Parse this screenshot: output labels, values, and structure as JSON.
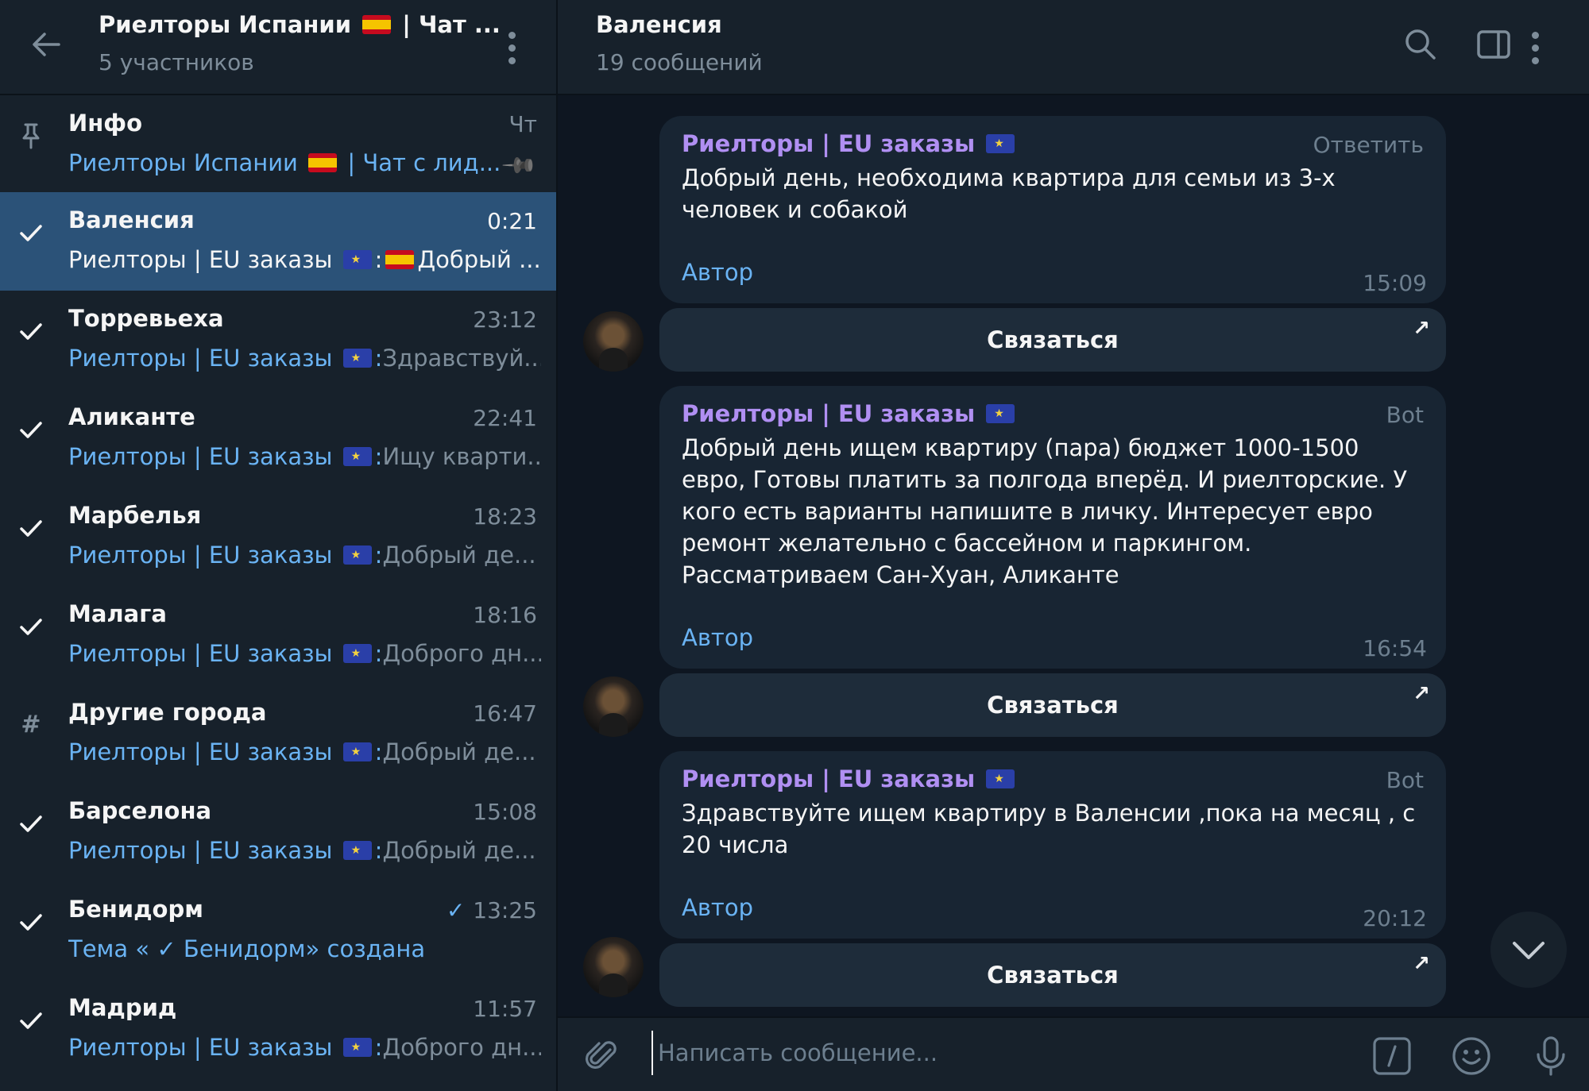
{
  "group": {
    "title": "Риелторы Испании 🇪🇸 | Чат ...",
    "title_text": "Риелторы Испании",
    "title_suffix": " | Чат ...",
    "members": "5 участников"
  },
  "topics": [
    {
      "name": "Инфо",
      "time": "Чт",
      "sender": "Риелторы Испании",
      "sender_suffix": " | Чат с лид...",
      "preview": "",
      "icon": "pin-icon",
      "active": false
    },
    {
      "name": "Валенсия",
      "time": "0:21",
      "sender": "Риелторы | EU заказы",
      "preview": "Добрый ...",
      "icon": "check-icon",
      "active": true
    },
    {
      "name": "Торревьеха",
      "time": "23:12",
      "sender": "Риелторы | EU заказы",
      "preview": "Здравствуй...",
      "icon": "check-icon",
      "active": false
    },
    {
      "name": "Аликанте",
      "time": "22:41",
      "sender": "Риелторы | EU заказы",
      "preview": "Ищу кварти...",
      "icon": "check-icon",
      "active": false
    },
    {
      "name": "Марбелья",
      "time": "18:23",
      "sender": "Риелторы | EU заказы",
      "preview": "Добрый де...",
      "icon": "check-icon",
      "active": false
    },
    {
      "name": "Малага",
      "time": "18:16",
      "sender": "Риелторы | EU заказы",
      "preview": "Доброго дн...",
      "icon": "check-icon",
      "active": false
    },
    {
      "name": "Другие города",
      "time": "16:47",
      "sender": "Риелторы | EU заказы",
      "preview": "Добрый де...",
      "icon": "hash-icon",
      "active": false
    },
    {
      "name": "Барселона",
      "time": "15:08",
      "sender": "Риелторы | EU заказы",
      "preview": "Добрый де...",
      "icon": "check-icon",
      "active": false
    },
    {
      "name": "Бенидорм",
      "time": "13:25",
      "sender": "Тема «",
      "preview": " Бенидорм» создана",
      "icon": "check-icon",
      "active": false
    },
    {
      "name": "Мадрид",
      "time": "11:57",
      "sender": "Риелторы | EU заказы",
      "preview": "Доброго дн...",
      "icon": "check-icon",
      "active": false
    }
  ],
  "chat": {
    "title": "Валенсия",
    "subtitle": "19 сообщений"
  },
  "messages": [
    {
      "sender": "Риелторы | EU заказы",
      "tag": "Ответить",
      "text": "Добрый день, необходима квартира для семьи из 3-х человек и собакой",
      "link": "Автор",
      "time": "15:09",
      "button": "Связаться"
    },
    {
      "sender": "Риелторы | EU заказы",
      "tag": "Bot",
      "text": "Добрый день ищем квартиру (пара) бюджет 1000-1500 евро, Готовы платить за полгода вперёд. И риелторские. У кого есть варианты напишите в личку. Интересует евро ремонт желательно с бассейном и паркингом. Рассматриваем Сан-Хуан, Аликанте",
      "link": "Автор",
      "time": "16:54",
      "button": "Связаться"
    },
    {
      "sender": "Риелторы | EU заказы",
      "tag": "Bot",
      "text": "Здравствуйте ищем квартиру в Валенсии ,пока на месяц , с 20 числа",
      "link": "Автор",
      "time": "20:12",
      "button": "Связаться"
    }
  ],
  "composer": {
    "placeholder": "Написать сообщение..."
  },
  "colors": {
    "background": "#0e1621",
    "panel": "#17212b",
    "active_topic": "#2b5278",
    "accent_blue": "#6ab3f3",
    "sender_purple": "#b08ff2",
    "muted": "#7e8d9a"
  }
}
